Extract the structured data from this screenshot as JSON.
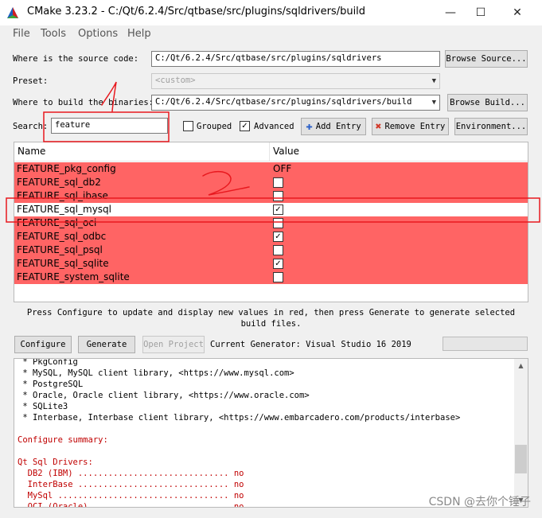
{
  "window": {
    "title": "CMake 3.23.2 - C:/Qt/6.2.4/Src/qtbase/src/plugins/sqldrivers/build",
    "minimize": "—",
    "maximize": "☐",
    "close": "✕"
  },
  "menu": [
    "File",
    "Tools",
    "Options",
    "Help"
  ],
  "source": {
    "label": "Where is the source code:",
    "value": "C:/Qt/6.2.4/Src/qtbase/src/plugins/sqldrivers",
    "button": "Browse Source..."
  },
  "preset": {
    "label": "Preset:",
    "value": "<custom>"
  },
  "build": {
    "label": "Where to build the binaries:",
    "value": "C:/Qt/6.2.4/Src/qtbase/src/plugins/sqldrivers/build",
    "button": "Browse Build..."
  },
  "search": {
    "label": "Search:",
    "value": "feature",
    "grouped_label": "Grouped",
    "grouped_checked": false,
    "advanced_label": "Advanced",
    "advanced_checked": true,
    "add_entry": "Add Entry",
    "remove_entry": "Remove Entry",
    "environment": "Environment..."
  },
  "table": {
    "columns": [
      "Name",
      "Value"
    ],
    "rows": [
      {
        "name": "FEATURE_pkg_config",
        "value": "OFF",
        "type": "text",
        "highlight": "red"
      },
      {
        "name": "FEATURE_sql_db2",
        "checked": false,
        "type": "bool",
        "highlight": "red"
      },
      {
        "name": "FEATURE_sql_ibase",
        "checked": false,
        "type": "bool",
        "highlight": "red"
      },
      {
        "name": "FEATURE_sql_mysql",
        "checked": true,
        "type": "bool",
        "highlight": "selected"
      },
      {
        "name": "FEATURE_sql_oci",
        "checked": false,
        "type": "bool",
        "highlight": "red"
      },
      {
        "name": "FEATURE_sql_odbc",
        "checked": true,
        "type": "bool",
        "highlight": "red"
      },
      {
        "name": "FEATURE_sql_psql",
        "checked": false,
        "type": "bool",
        "highlight": "red"
      },
      {
        "name": "FEATURE_sql_sqlite",
        "checked": true,
        "type": "bool",
        "highlight": "red"
      },
      {
        "name": "FEATURE_system_sqlite",
        "checked": false,
        "type": "bool",
        "highlight": "red"
      }
    ]
  },
  "hint": "Press Configure to update and display new values in red, then press Generate to generate selected build files.",
  "actions": {
    "configure": "Configure",
    "generate": "Generate",
    "open_project": "Open Project",
    "generator_label": "Current Generator: Visual Studio 16 2019"
  },
  "log": [
    {
      "text": " * PkgConfig",
      "color": "black"
    },
    {
      "text": " * MySQL, MySQL client library, <https://www.mysql.com>",
      "color": "black"
    },
    {
      "text": " * PostgreSQL",
      "color": "black"
    },
    {
      "text": " * Oracle, Oracle client library, <https://www.oracle.com>",
      "color": "black"
    },
    {
      "text": " * SQLite3",
      "color": "black"
    },
    {
      "text": " * Interbase, Interbase client library, <https://www.embarcadero.com/products/interbase>",
      "color": "black"
    },
    {
      "text": "",
      "color": "black"
    },
    {
      "text": "Configure summary:",
      "color": "red"
    },
    {
      "text": "",
      "color": "black"
    },
    {
      "text": "Qt Sql Drivers:",
      "color": "red"
    },
    {
      "text": "  DB2 (IBM) .............................. no",
      "color": "red"
    },
    {
      "text": "  InterBase .............................. no",
      "color": "red"
    },
    {
      "text": "  MySql .................................. no",
      "color": "red"
    },
    {
      "text": "  OCI (Oracle) ........................... no",
      "color": "red"
    }
  ],
  "annotations": {
    "mark1": "1",
    "mark2": "2",
    "color": "#e8181e"
  },
  "watermark": "CSDN @去你个锤子",
  "colors": {
    "highlight_row": "#ff6464",
    "log_red": "#c00000",
    "annotation": "#e8181e"
  }
}
